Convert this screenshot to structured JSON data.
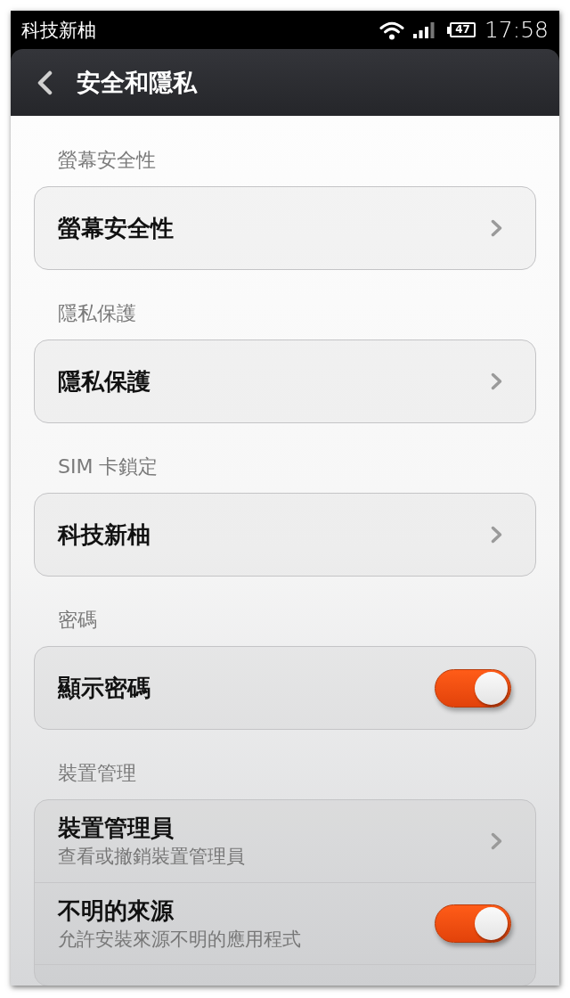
{
  "status_bar": {
    "carrier": "科技新柚",
    "battery": "47",
    "time": "17:58"
  },
  "header": {
    "title": "安全和隱私"
  },
  "sections": [
    {
      "title": "螢幕安全性",
      "items": [
        {
          "kind": "link",
          "label": "螢幕安全性"
        }
      ]
    },
    {
      "title": "隱私保護",
      "items": [
        {
          "kind": "link",
          "label": "隱私保護"
        }
      ]
    },
    {
      "title": "SIM 卡鎖定",
      "items": [
        {
          "kind": "link",
          "label": "科技新柚"
        }
      ]
    },
    {
      "title": "密碼",
      "items": [
        {
          "kind": "toggle",
          "label": "顯示密碼",
          "on": true
        }
      ]
    },
    {
      "title": "裝置管理",
      "items": [
        {
          "kind": "link",
          "label": "裝置管理員",
          "summary": "查看或撤銷裝置管理員"
        },
        {
          "kind": "toggle",
          "label": "不明的來源",
          "summary": "允許安裝來源不明的應用程式",
          "on": true
        },
        {
          "kind": "partial"
        }
      ]
    }
  ]
}
